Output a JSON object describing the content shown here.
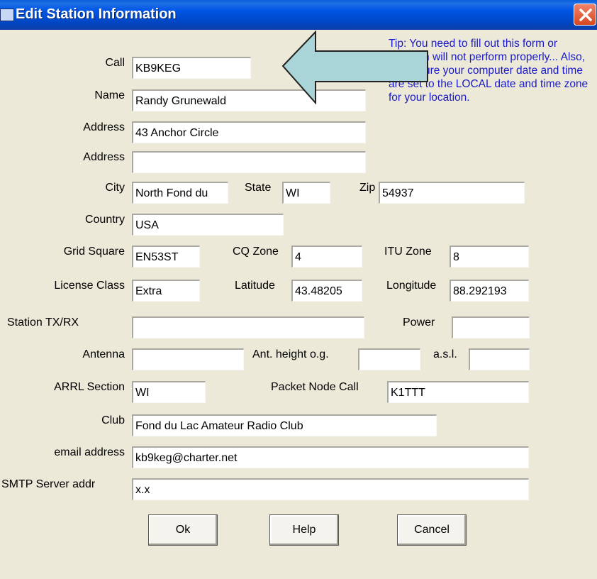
{
  "window": {
    "title": "Edit Station Information"
  },
  "tip": "Tip: You need to fill out this form or program will not perform properly... Also, make sure your computer date and time are set to the LOCAL date and time zone for your location.",
  "fields": {
    "call": {
      "label": "Call",
      "value": "KB9KEG"
    },
    "name": {
      "label": "Name",
      "value": "Randy Grunewald"
    },
    "address1": {
      "label": "Address",
      "value": "43 Anchor Circle"
    },
    "address2": {
      "label": "Address",
      "value": ""
    },
    "city": {
      "label": "City",
      "value": "North Fond du"
    },
    "state": {
      "label": "State",
      "value": "WI"
    },
    "zip": {
      "label": "Zip",
      "value": "54937"
    },
    "country": {
      "label": "Country",
      "value": "USA"
    },
    "grid": {
      "label": "Grid Square",
      "value": "EN53ST"
    },
    "cq_zone": {
      "label": "CQ Zone",
      "value": "4"
    },
    "itu_zone": {
      "label": "ITU Zone",
      "value": "8"
    },
    "license": {
      "label": "License Class",
      "value": "Extra"
    },
    "latitude": {
      "label": "Latitude",
      "value": "43.48205"
    },
    "longitude": {
      "label": "Longitude",
      "value": "88.292193"
    },
    "station": {
      "label": "Station TX/RX",
      "value": ""
    },
    "power": {
      "label": "Power",
      "value": ""
    },
    "antenna": {
      "label": "Antenna",
      "value": ""
    },
    "ant_height": {
      "label": "Ant. height o.g.",
      "value": ""
    },
    "asl": {
      "label": "a.s.l.",
      "value": ""
    },
    "arrl": {
      "label": "ARRL Section",
      "value": "WI"
    },
    "packet": {
      "label": "Packet Node Call",
      "value": "K1TTT"
    },
    "club": {
      "label": "Club",
      "value": "Fond du Lac Amateur Radio Club"
    },
    "email": {
      "label": "email address",
      "value": "kb9keg@charter.net"
    },
    "smtp": {
      "label": "SMTP Server addr",
      "value": "x.x"
    }
  },
  "buttons": {
    "ok": "Ok",
    "help": "Help",
    "cancel": "Cancel"
  },
  "colors": {
    "title_bar": "#0055e5",
    "tip_text": "#1a1ac8",
    "arrow_fill": "#a9d4d8",
    "dialog_bg": "#ece9d8"
  }
}
